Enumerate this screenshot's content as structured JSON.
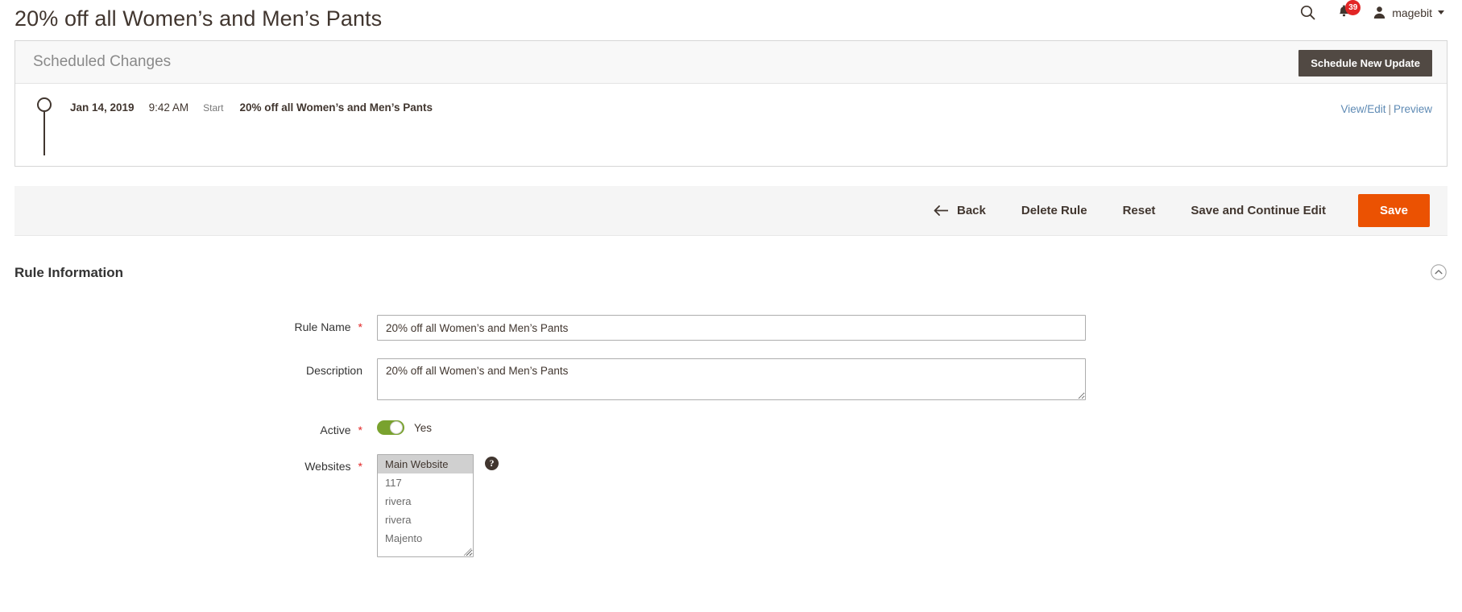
{
  "header": {
    "page_title": "20% off all Women’s and Men’s Pants",
    "search_icon": "search-icon",
    "notifications_icon": "bell-icon",
    "notifications_count": "39",
    "user_icon": "user-avatar-icon",
    "user_name": "magebit",
    "caret_icon": "chevron-down-icon"
  },
  "scheduled_changes": {
    "title": "Scheduled Changes",
    "new_update_button": "Schedule New Update",
    "entries": [
      {
        "date": "Jan 14, 2019",
        "time": "9:42 AM",
        "type": "Start",
        "name": "20% off all Women’s and Men’s Pants",
        "view_edit_link": "View/Edit",
        "separator": "|",
        "preview_link": "Preview"
      }
    ]
  },
  "actions": {
    "back": "Back",
    "back_icon": "arrow-left-icon",
    "delete_rule": "Delete Rule",
    "reset": "Reset",
    "save_and_continue": "Save and Continue Edit",
    "save": "Save",
    "save_color": "#eb5202"
  },
  "rule_information": {
    "section_title": "Rule Information",
    "collapse_icon": "chevron-up-circle-icon",
    "fields": {
      "rule_name": {
        "label": "Rule Name",
        "required": "*",
        "value": "20% off all Women’s and Men’s Pants",
        "placeholder": ""
      },
      "description": {
        "label": "Description",
        "required": "",
        "value": "20% off all Women’s and Men’s Pants",
        "placeholder": ""
      },
      "active": {
        "label": "Active",
        "required": "*",
        "state_label": "Yes",
        "toggle_color": "#79a22e"
      },
      "websites": {
        "label": "Websites",
        "required": "*",
        "help_icon": "question-mark-icon",
        "options": [
          {
            "label": "Main Website",
            "selected": true
          },
          {
            "label": "117",
            "selected": false
          },
          {
            "label": "rivera",
            "selected": false
          },
          {
            "label": "rivera",
            "selected": false
          },
          {
            "label": "Majento",
            "selected": false
          }
        ]
      }
    }
  }
}
